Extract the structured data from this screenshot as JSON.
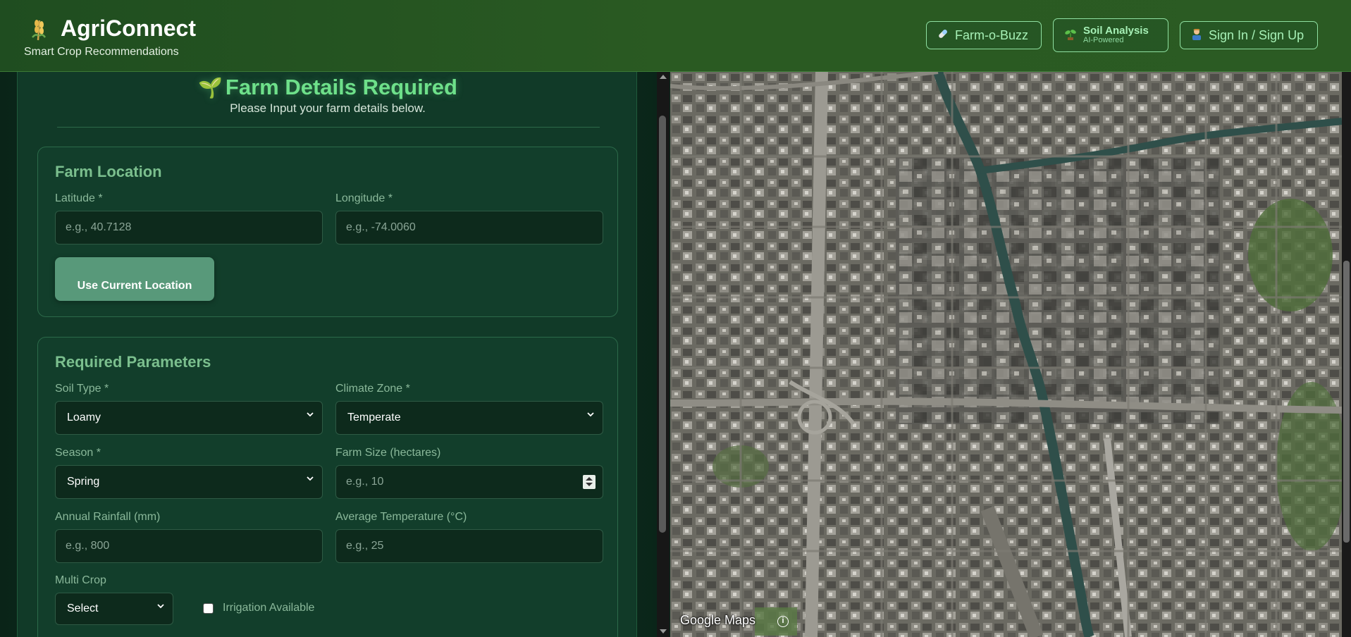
{
  "header": {
    "app_title": "AgriConnect",
    "subtitle": "Smart Crop Recommendations",
    "nav": {
      "buzz_label": "Farm-o-Buzz",
      "soil_label": "Soil Analysis",
      "soil_sub": "AI-Powered",
      "signin_label": "Sign In / Sign Up"
    }
  },
  "form": {
    "title": "Farm Details Required",
    "subtitle": "Please Input your farm details below.",
    "location": {
      "title": "Farm Location",
      "latitude_label": "Latitude *",
      "latitude_placeholder": "e.g., 40.7128",
      "longitude_label": "Longitude *",
      "longitude_placeholder": "e.g., -74.0060",
      "use_location_label": "Use Current Location"
    },
    "params": {
      "title": "Required Parameters",
      "soil_label": "Soil Type *",
      "soil_value": "Loamy",
      "climate_label": "Climate Zone *",
      "climate_value": "Temperate",
      "season_label": "Season *",
      "season_value": "Spring",
      "farm_size_label": "Farm Size (hectares)",
      "farm_size_placeholder": "e.g., 10",
      "rainfall_label": "Annual Rainfall (mm)",
      "rainfall_placeholder": "e.g., 800",
      "temp_label": "Average Temperature (°C)",
      "temp_placeholder": "e.g., 25",
      "multicrop_label": "Multi Crop",
      "multicrop_value": "Select",
      "irrigation_label": "Irrigation Available"
    }
  },
  "map": {
    "logo": "Google Maps",
    "info_symbol": "i"
  },
  "colors": {
    "header_bg": "#2a5a22",
    "accent_green": "#6ee08a",
    "button_fill": "#58997a"
  }
}
